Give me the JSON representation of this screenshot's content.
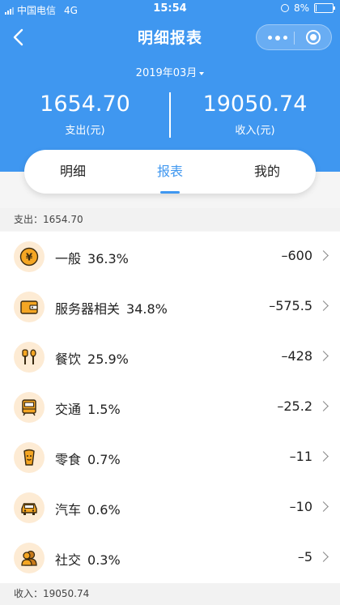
{
  "status": {
    "carrier": "中国电信",
    "network": "4G",
    "time": "15:54",
    "battery": "8%",
    "battery_level": 0.08
  },
  "nav": {
    "title": "明细报表"
  },
  "month": {
    "label": "2019年03月"
  },
  "summary": {
    "expense_amount": "1654.70",
    "expense_label": "支出(元)",
    "income_amount": "19050.74",
    "income_label": "收入(元)"
  },
  "tabs": [
    {
      "label": "明细"
    },
    {
      "label": "报表"
    },
    {
      "label": "我的"
    }
  ],
  "expense_header": "支出：1654.70",
  "income_header": "收入：19050.74",
  "items": [
    {
      "name": "一般",
      "percent": "36.3%",
      "value": "–600",
      "icon": "yen-coin-icon"
    },
    {
      "name": "服务器相关",
      "percent": "34.8%",
      "value": "–575.5",
      "icon": "wallet-icon"
    },
    {
      "name": "餐饮",
      "percent": "25.9%",
      "value": "–428",
      "icon": "fork-spoon-icon"
    },
    {
      "name": "交通",
      "percent": "1.5%",
      "value": "–25.2",
      "icon": "train-icon"
    },
    {
      "name": "零食",
      "percent": "0.7%",
      "value": "–11",
      "icon": "snack-icon"
    },
    {
      "name": "汽车",
      "percent": "0.6%",
      "value": "–10",
      "icon": "car-icon"
    },
    {
      "name": "社交",
      "percent": "0.3%",
      "value": "–5",
      "icon": "people-icon"
    }
  ],
  "colors": {
    "primary": "#3f97f0",
    "icon_fill": "#f5a623",
    "icon_bg": "#fdebd4"
  }
}
